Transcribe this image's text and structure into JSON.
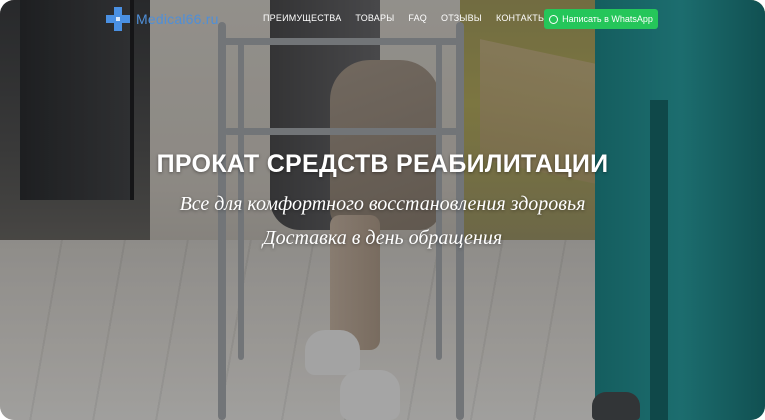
{
  "header": {
    "logo_text": "Medical66.ru",
    "nav": [
      "ПРЕИМУЩЕСТВА",
      "ТОВАРЫ",
      "FAQ",
      "ОТЗЫВЫ",
      "КОНТАКТЫ"
    ],
    "whatsapp_label": "Написать в WhatsApp"
  },
  "hero": {
    "title": "ПРОКАТ СРЕДСТВ РЕАБИЛИТАЦИИ",
    "subtitle": "Все для комфортного восстановления здоровья",
    "subtitle2": "Доставка в день обращения"
  },
  "icons": {
    "logo": "medical-cross-icon",
    "whatsapp": "whatsapp-icon"
  },
  "colors": {
    "brand": "#4a90e2",
    "whatsapp": "#25c65a"
  }
}
